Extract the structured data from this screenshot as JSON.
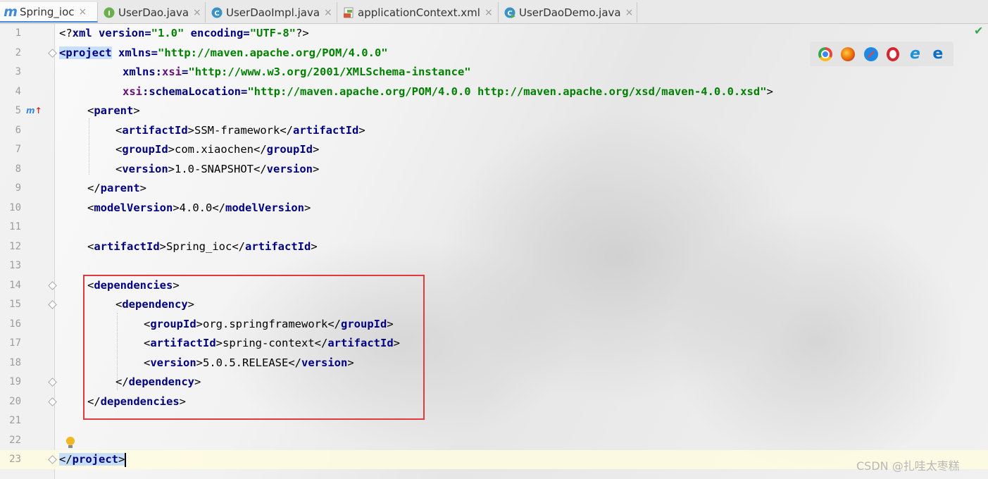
{
  "tabs": [
    {
      "label": "Spring_ioc",
      "icon": "maven-module-icon",
      "active": true
    },
    {
      "label": "UserDao.java",
      "icon": "interface-icon",
      "active": false
    },
    {
      "label": "UserDaoImpl.java",
      "icon": "class-icon",
      "active": false
    },
    {
      "label": "applicationContext.xml",
      "icon": "xml-file-icon",
      "active": false
    },
    {
      "label": "UserDaoDemo.java",
      "icon": "runnable-class-icon",
      "active": false
    }
  ],
  "tab_close_glyph": "×",
  "editor": {
    "line_numbers": [
      "1",
      "2",
      "3",
      "4",
      "5",
      "6",
      "7",
      "8",
      "9",
      "10",
      "11",
      "12",
      "13",
      "14",
      "15",
      "16",
      "17",
      "18",
      "19",
      "20",
      "21",
      "22",
      "23"
    ],
    "current_line": "23",
    "gutter_marker": {
      "label": "m",
      "arrow": "↑",
      "line": "5"
    },
    "lines": {
      "l1": {
        "p1": "<?",
        "p2": "xml",
        "p3": " version",
        "p4": "=",
        "p5": "\"1.0\"",
        "p6": " encoding",
        "p7": "=",
        "p8": "\"UTF-8\"",
        "p9": "?>"
      },
      "l2": {
        "tag": "<project",
        "attr": " xmlns",
        "eq": "=",
        "val": "\"http://maven.apache.org/POM/4.0.0\""
      },
      "l3": {
        "ns": "xmlns",
        "colon": ":",
        "attr": "xsi",
        "eq": "=",
        "val": "\"http://www.w3.org/2001/XMLSchema-instance\""
      },
      "l4": {
        "ns": "xsi",
        "colon": ":",
        "attr": "schemaLocation",
        "eq": "=",
        "val": "\"http://maven.apache.org/POM/4.0.0 http://maven.apache.org/xsd/maven-4.0.0.xsd\"",
        "close": ">"
      },
      "l5": {
        "open": "<",
        "tag": "parent",
        "close": ">"
      },
      "l6": {
        "open": "<",
        "tag": "artifactId",
        "gt": ">",
        "text": "SSM-framework",
        "endopen": "</",
        "endtag": "artifactId",
        "endgt": ">"
      },
      "l7": {
        "open": "<",
        "tag": "groupId",
        "gt": ">",
        "text": "com.xiaochen",
        "endopen": "</",
        "endtag": "groupId",
        "endgt": ">"
      },
      "l8": {
        "open": "<",
        "tag": "version",
        "gt": ">",
        "text": "1.0-SNAPSHOT",
        "endopen": "</",
        "endtag": "version",
        "endgt": ">"
      },
      "l9": {
        "open": "</",
        "tag": "parent",
        "close": ">"
      },
      "l10": {
        "open": "<",
        "tag": "modelVersion",
        "gt": ">",
        "text": "4.0.0",
        "endopen": "</",
        "endtag": "modelVersion",
        "endgt": ">"
      },
      "l12": {
        "open": "<",
        "tag": "artifactId",
        "gt": ">",
        "text": "Spring_ioc",
        "endopen": "</",
        "endtag": "artifactId",
        "endgt": ">"
      },
      "l14": {
        "open": "<",
        "tag": "dependencies",
        "close": ">"
      },
      "l15": {
        "open": "<",
        "tag": "dependency",
        "close": ">"
      },
      "l16": {
        "open": "<",
        "tag": "groupId",
        "gt": ">",
        "text": "org.springframework",
        "endopen": "</",
        "endtag": "groupId",
        "endgt": ">"
      },
      "l17": {
        "open": "<",
        "tag": "artifactId",
        "gt": ">",
        "text": "spring-context",
        "endopen": "</",
        "endtag": "artifactId",
        "endgt": ">"
      },
      "l18": {
        "open": "<",
        "tag": "version",
        "gt": ">",
        "text": "5.0.5.RELEASE",
        "endopen": "</",
        "endtag": "version",
        "endgt": ">"
      },
      "l19": {
        "open": "</",
        "tag": "dependency",
        "close": ">"
      },
      "l20": {
        "open": "</",
        "tag": "dependencies",
        "close": ">"
      },
      "l23": {
        "open": "</",
        "tag": "project",
        "close": ">"
      }
    }
  },
  "browser_icons": [
    "chrome-icon",
    "firefox-icon",
    "safari-icon",
    "opera-icon",
    "ie-icon",
    "edge-icon"
  ],
  "colors": {
    "chrome": "#e8453c",
    "firefox": "#e66000",
    "safari": "#1e88e5",
    "opera": "#d9232e",
    "ie": "#1e90d8",
    "edge": "#0a6fc2",
    "highlight_box": "#e03a3a"
  },
  "status_check": "✔",
  "watermark": "CSDN @扎哇太枣糕"
}
